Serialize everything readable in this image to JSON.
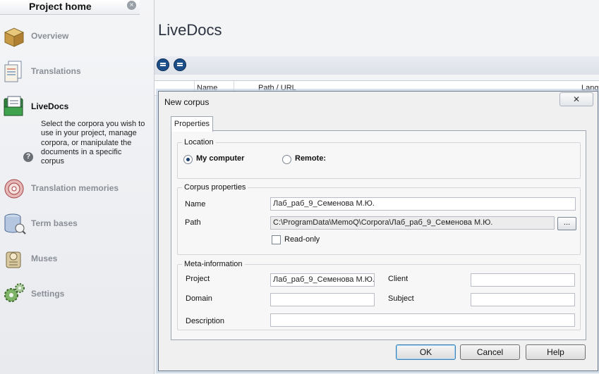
{
  "sidebar": {
    "header_title": "Project home",
    "close_glyph": "×",
    "items": [
      {
        "label": "Overview",
        "icon": "box-icon"
      },
      {
        "label": "Translations",
        "icon": "documents-icon"
      },
      {
        "label": "LiveDocs",
        "icon": "livedocs-icon",
        "active": true
      },
      {
        "label": "Translation memories",
        "icon": "tm-disc-icon"
      },
      {
        "label": "Term bases",
        "icon": "termbase-icon"
      },
      {
        "label": "Muses",
        "icon": "muses-icon"
      },
      {
        "label": "Settings",
        "icon": "gears-icon"
      }
    ],
    "livedocs_description": "Select the corpora you wish to use in your project, manage corpora, or manipulate the documents in a specific corpus",
    "help_glyph": "?"
  },
  "main": {
    "title": "LiveDocs",
    "columns": [
      "Name",
      "Path / URL",
      "Lang"
    ]
  },
  "dialog": {
    "title": "New corpus",
    "close_glyph": "✕",
    "tab": "Properties",
    "location": {
      "label": "Location",
      "options": [
        "My computer",
        "Remote:"
      ],
      "selected": "My computer"
    },
    "corpus_properties": {
      "label": "Corpus properties",
      "name_label": "Name",
      "name_value": "Лаб_раб_9_Семенова М.Ю.",
      "path_label": "Path",
      "path_value": "C:\\ProgramData\\MemoQ\\Corpora\\Лаб_раб_9_Семенова М.Ю.",
      "browse_label": "...",
      "readonly_label": "Read-only",
      "readonly_checked": false
    },
    "meta": {
      "label": "Meta-information",
      "project_label": "Project",
      "project_value": "Лаб_раб_9_Семенова М.Ю.",
      "client_label": "Client",
      "client_value": "",
      "domain_label": "Domain",
      "domain_value": "",
      "subject_label": "Subject",
      "subject_value": "",
      "description_label": "Description",
      "description_value": ""
    },
    "buttons": {
      "ok": "OK",
      "cancel": "Cancel",
      "help": "Help"
    }
  }
}
